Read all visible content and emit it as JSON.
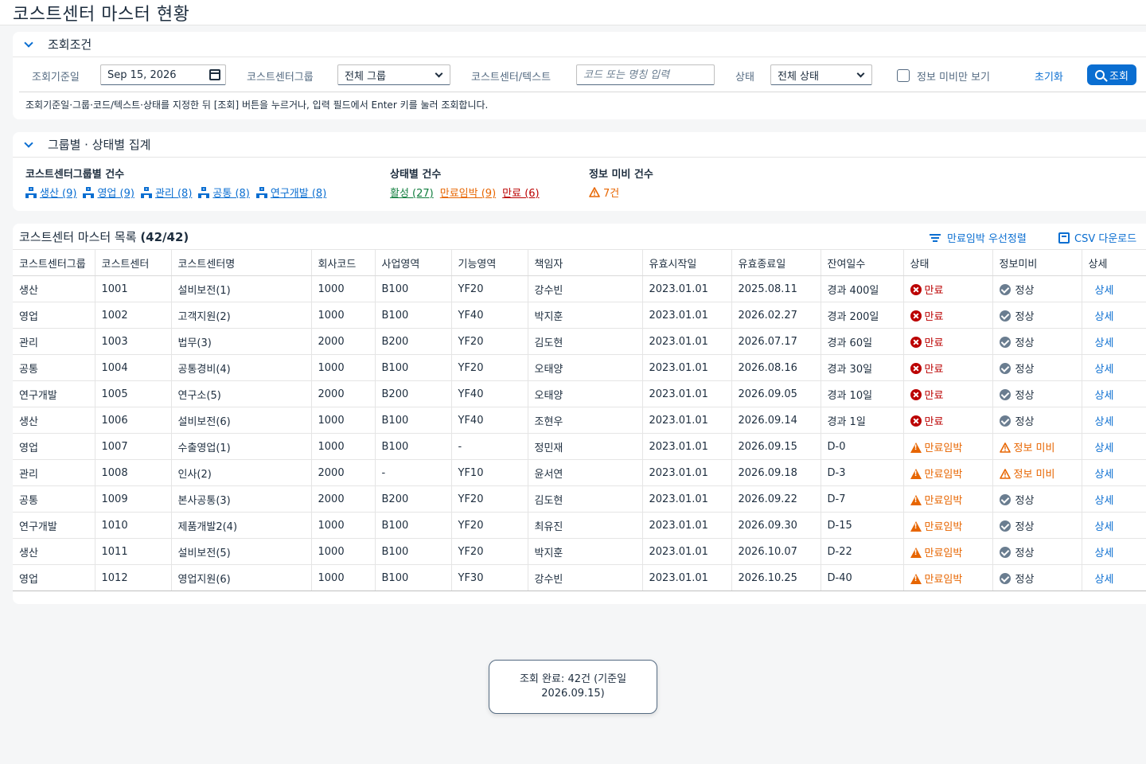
{
  "page": {
    "title": "코스트센터 마스터 현황"
  },
  "filter": {
    "section_title": "조회조건",
    "date_label": "조회기준일",
    "date_value": "Sep 15, 2026",
    "group_label": "코스트센터그룹",
    "group_value": "전체 그룹",
    "text_label": "코스트센터/텍스트",
    "text_placeholder": "코드 또는 명칭 입력",
    "status_label": "상태",
    "status_value": "전체 상태",
    "missing_only_label": "정보 미비만 보기",
    "reset_label": "초기화",
    "search_label": "조회",
    "hint": "조회기준일·그룹·코드/텍스트·상태를 지정한 뒤 [조회] 버튼을 누르거나, 입력 필드에서 Enter 키를 눌러 조회합니다."
  },
  "summary": {
    "section_title": "그룹별 · 상태별 집계",
    "group_label": "코스트센터그룹별 건수",
    "groups": [
      "생산 (9)",
      "영업 (9)",
      "관리 (8)",
      "공통 (8)",
      "연구개발 (8)"
    ],
    "status_label": "상태별 건수",
    "status_active": "활성 (27)",
    "status_warn": "만료임박 (9)",
    "status_expired": "만료 (6)",
    "missing_label": "정보 미비 건수",
    "missing_value": "7건",
    "colors": {
      "active": "#107e3e",
      "warn": "#e76500",
      "expired": "#bb0000",
      "link": "#0a6ed1"
    }
  },
  "list": {
    "title": "코스트센터 마스터 목록",
    "count": "(42/42)",
    "sort_label": "만료임박 우선정렬",
    "csv_label": "CSV 다운로드",
    "columns": [
      "코스트센터그룹",
      "코스트센터",
      "코스트센터명",
      "회사코드",
      "사업영역",
      "기능영역",
      "책임자",
      "유효시작일",
      "유효종료일",
      "잔여일수",
      "상태",
      "정보미비",
      "상세"
    ],
    "rows": [
      [
        "생산",
        "1001",
        "설비보전(1)",
        "1000",
        "B100",
        "YF20",
        "강수빈",
        "2023.01.01",
        "2025.08.11",
        "경과 400일",
        "만료",
        "정상",
        "상세"
      ],
      [
        "영업",
        "1002",
        "고객지원(2)",
        "1000",
        "B100",
        "YF40",
        "박지훈",
        "2023.01.01",
        "2026.02.27",
        "경과 200일",
        "만료",
        "정상",
        "상세"
      ],
      [
        "관리",
        "1003",
        "법무(3)",
        "2000",
        "B200",
        "YF20",
        "김도현",
        "2023.01.01",
        "2026.07.17",
        "경과 60일",
        "만료",
        "정상",
        "상세"
      ],
      [
        "공통",
        "1004",
        "공통경비(4)",
        "1000",
        "B100",
        "YF20",
        "오태양",
        "2023.01.01",
        "2026.08.16",
        "경과 30일",
        "만료",
        "정상",
        "상세"
      ],
      [
        "연구개발",
        "1005",
        "연구소(5)",
        "2000",
        "B200",
        "YF40",
        "오태양",
        "2023.01.01",
        "2026.09.05",
        "경과 10일",
        "만료",
        "정상",
        "상세"
      ],
      [
        "생산",
        "1006",
        "설비보전(6)",
        "1000",
        "B100",
        "YF40",
        "조현우",
        "2023.01.01",
        "2026.09.14",
        "경과 1일",
        "만료",
        "정상",
        "상세"
      ],
      [
        "영업",
        "1007",
        "수출영업(1)",
        "1000",
        "B100",
        "-",
        "정민재",
        "2023.01.01",
        "2026.09.15",
        "D-0",
        "만료임박",
        "정보 미비",
        "상세"
      ],
      [
        "관리",
        "1008",
        "인사(2)",
        "2000",
        "-",
        "YF10",
        "윤서연",
        "2023.01.01",
        "2026.09.18",
        "D-3",
        "만료임박",
        "정보 미비",
        "상세"
      ],
      [
        "공통",
        "1009",
        "본사공통(3)",
        "2000",
        "B200",
        "YF20",
        "김도현",
        "2023.01.01",
        "2026.09.22",
        "D-7",
        "만료임박",
        "정상",
        "상세"
      ],
      [
        "연구개발",
        "1010",
        "제품개발2(4)",
        "1000",
        "B100",
        "YF20",
        "최유진",
        "2023.01.01",
        "2026.09.30",
        "D-15",
        "만료임박",
        "정상",
        "상세"
      ],
      [
        "생산",
        "1011",
        "설비보전(5)",
        "1000",
        "B100",
        "YF20",
        "박지훈",
        "2023.01.01",
        "2026.10.07",
        "D-22",
        "만료임박",
        "정상",
        "상세"
      ],
      [
        "영업",
        "1012",
        "영업지원(6)",
        "1000",
        "B100",
        "YF30",
        "강수빈",
        "2023.01.01",
        "2026.10.25",
        "D-40",
        "만료임박",
        "정상",
        "상세"
      ]
    ]
  },
  "toast": {
    "message": "조회 완료: 42건 (기준일 2026.09.15)"
  }
}
